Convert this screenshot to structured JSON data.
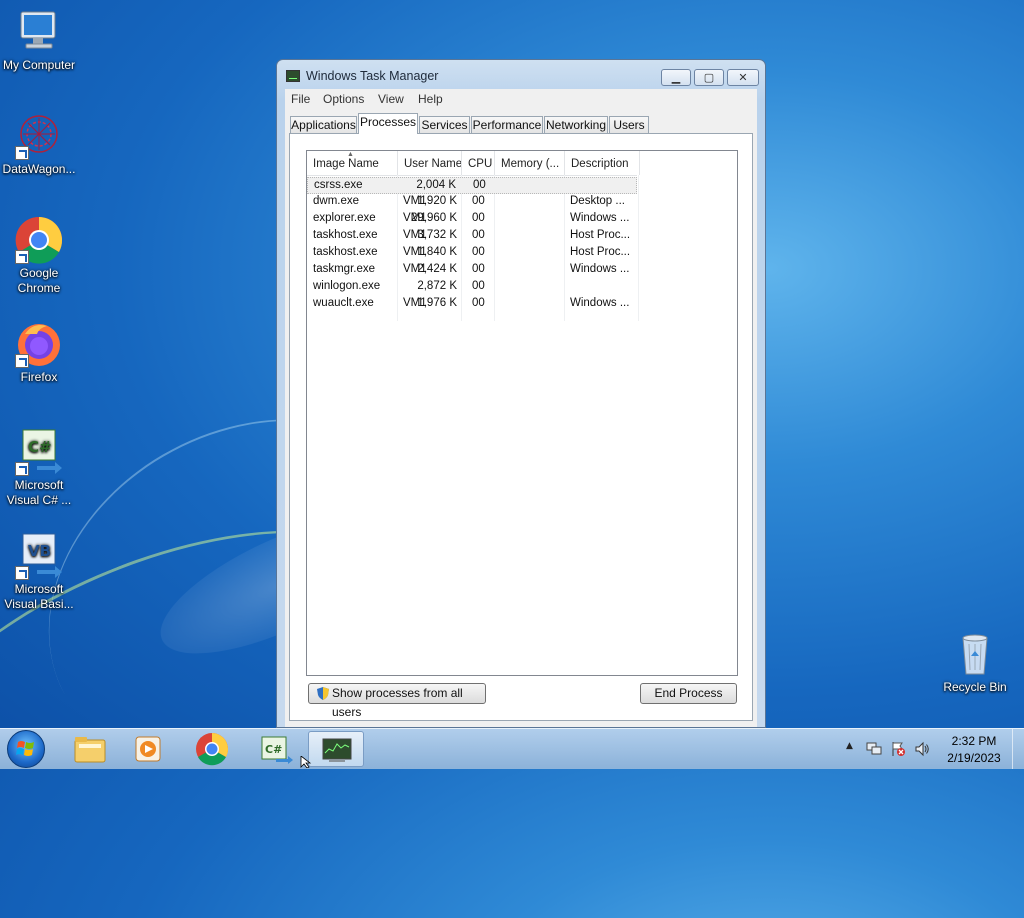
{
  "desktop": {
    "icons": [
      {
        "label": "My Computer"
      },
      {
        "label": "DataWagon..."
      },
      {
        "label": "Google Chrome"
      },
      {
        "label": "Firefox"
      },
      {
        "label": "Microsoft Visual C# ..."
      },
      {
        "label": "Microsoft Visual Basi..."
      },
      {
        "label": "Recycle Bin"
      }
    ]
  },
  "window": {
    "title": "Windows Task Manager",
    "caption_buttons": {
      "minimize": "▁",
      "maximize": "▢",
      "close": "✕"
    },
    "menu": [
      "File",
      "Options",
      "View",
      "Help"
    ],
    "tabs": [
      "Applications",
      "Processes",
      "Services",
      "Performance",
      "Networking",
      "Users"
    ],
    "active_tab": "Processes",
    "columns": [
      "Image Name",
      "User Name",
      "CPU",
      "Memory (...",
      "Description"
    ],
    "rows": [
      {
        "image": "csrss.exe",
        "user": "",
        "cpu": "00",
        "memory": "2,004 K",
        "desc": ""
      },
      {
        "image": "dwm.exe",
        "user": "VM1",
        "cpu": "00",
        "memory": "1,920 K",
        "desc": "Desktop ..."
      },
      {
        "image": "explorer.exe",
        "user": "VM1",
        "cpu": "00",
        "memory": "29,960 K",
        "desc": "Windows ..."
      },
      {
        "image": "taskhost.exe",
        "user": "VM1",
        "cpu": "00",
        "memory": "3,732 K",
        "desc": "Host Proc..."
      },
      {
        "image": "taskhost.exe",
        "user": "VM1",
        "cpu": "00",
        "memory": "1,840 K",
        "desc": "Host Proc..."
      },
      {
        "image": "taskmgr.exe",
        "user": "VM1",
        "cpu": "00",
        "memory": "2,424 K",
        "desc": "Windows ..."
      },
      {
        "image": "winlogon.exe",
        "user": "",
        "cpu": "00",
        "memory": "2,872 K",
        "desc": ""
      },
      {
        "image": "wuauclt.exe",
        "user": "VM1",
        "cpu": "00",
        "memory": "1,976 K",
        "desc": "Windows ..."
      }
    ],
    "show_all_label": "Show processes from all users",
    "end_process_label": "End Process"
  },
  "taskbar": {
    "apps": [
      "windows-explorer",
      "media-player",
      "google-chrome",
      "visual-csharp",
      "task-manager"
    ],
    "clock": {
      "time": "2:32 PM",
      "date": "2/19/2023"
    }
  }
}
